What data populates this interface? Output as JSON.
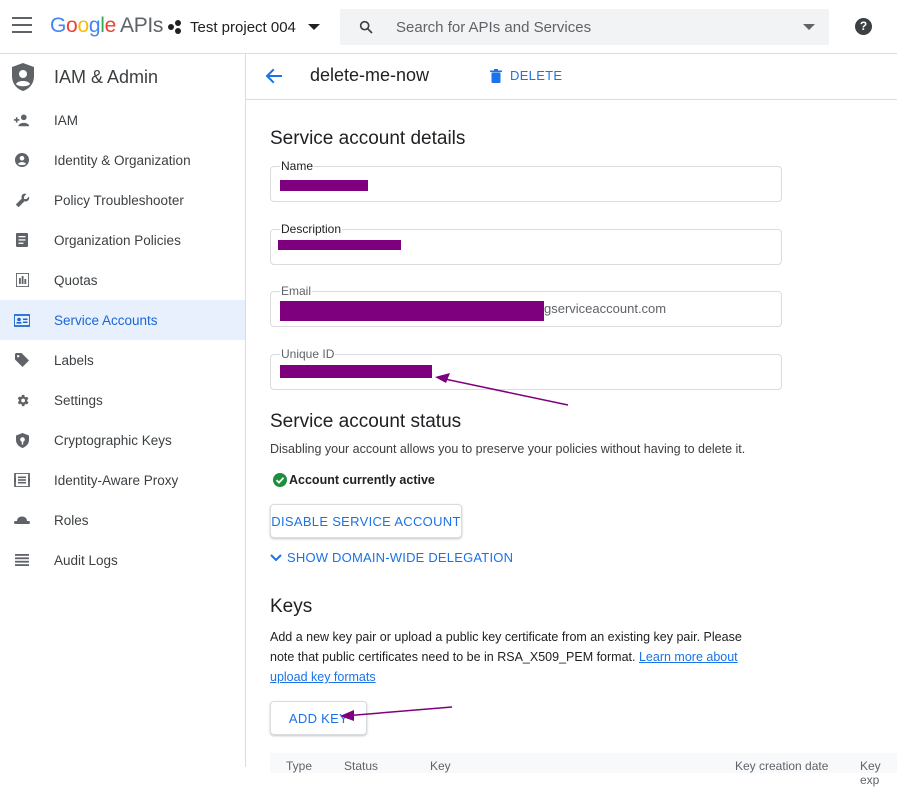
{
  "topbar": {
    "logo_g": "G",
    "logo_o1": "o",
    "logo_o2": "o",
    "logo_g2": "g",
    "logo_l": "l",
    "logo_e": "e",
    "logo_apis": "APIs",
    "project": "Test project 004",
    "search_placeholder": "Search for APIs and Services",
    "help": "?"
  },
  "sidebar": {
    "title": "IAM & Admin",
    "items": [
      {
        "label": "IAM",
        "icon": "person-add-icon"
      },
      {
        "label": "Identity & Organization",
        "icon": "account-circle-icon"
      },
      {
        "label": "Policy Troubleshooter",
        "icon": "wrench-icon"
      },
      {
        "label": "Organization Policies",
        "icon": "document-icon"
      },
      {
        "label": "Quotas",
        "icon": "quota-icon"
      },
      {
        "label": "Service Accounts",
        "icon": "service-account-icon",
        "active": true
      },
      {
        "label": "Labels",
        "icon": "label-icon"
      },
      {
        "label": "Settings",
        "icon": "gear-icon"
      },
      {
        "label": "Cryptographic Keys",
        "icon": "shield-key-icon"
      },
      {
        "label": "Identity-Aware Proxy",
        "icon": "proxy-icon"
      },
      {
        "label": "Roles",
        "icon": "hat-icon"
      },
      {
        "label": "Audit Logs",
        "icon": "list-icon"
      }
    ]
  },
  "header": {
    "account_name": "delete-me-now",
    "delete_label": "DELETE"
  },
  "details": {
    "title": "Service account details",
    "name_label": "Name",
    "description_label": "Description",
    "email_label": "Email",
    "email_suffix": "gserviceaccount.com",
    "unique_id_label": "Unique ID"
  },
  "status": {
    "title": "Service account status",
    "description": "Disabling your account allows you to preserve your policies without having to delete it.",
    "active_text": "Account currently active",
    "disable_button": "DISABLE SERVICE ACCOUNT",
    "delegation_link": "SHOW DOMAIN-WIDE DELEGATION"
  },
  "keys": {
    "title": "Keys",
    "description_1": "Add a new key pair or upload a public key certificate from an existing key pair. Please",
    "description_2": "note that public certificates need to be in RSA_X509_PEM format.",
    "learn_more_1": "Learn more about",
    "learn_more_2": "upload key formats",
    "add_key_button": "ADD KEY",
    "columns": [
      "Type",
      "Status",
      "Key",
      "Key creation date",
      "Key exp"
    ]
  },
  "colors": {
    "accent": "#1a73e8",
    "active_bg": "#e8f0fe",
    "redaction": "#7e007e",
    "success": "#1e8e3e"
  }
}
